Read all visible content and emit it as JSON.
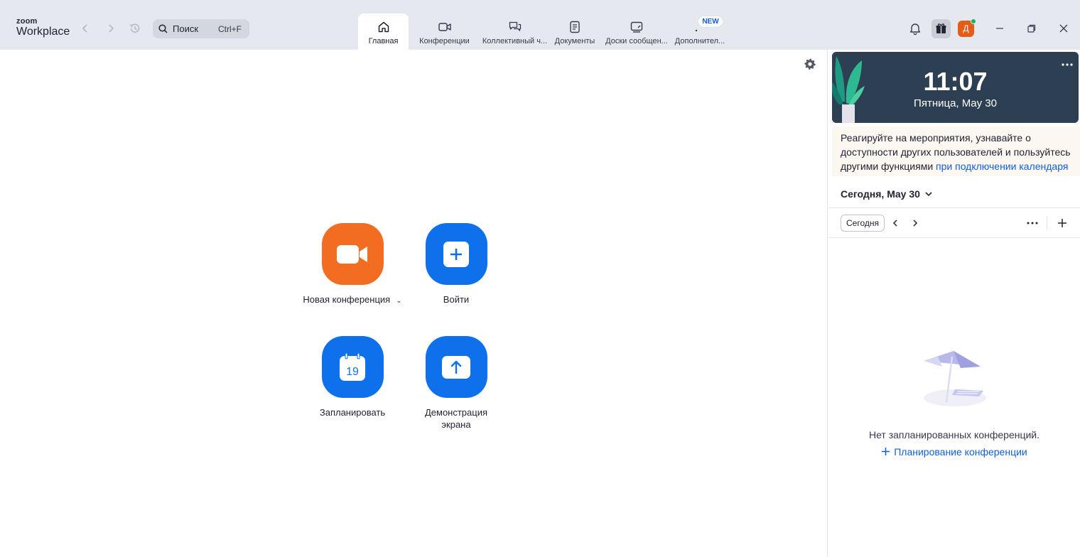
{
  "app": {
    "logo_small": "zoom",
    "logo_big": "Workplace"
  },
  "search": {
    "placeholder": "Поиск",
    "shortcut": "Ctrl+F"
  },
  "tabs": [
    {
      "label": "Главная",
      "icon": "home-icon",
      "active": true
    },
    {
      "label": "Конференции",
      "icon": "video-camera-icon",
      "active": false
    },
    {
      "label": "Коллективный ч...",
      "icon": "chat-icon",
      "active": false
    },
    {
      "label": "Документы",
      "icon": "document-icon",
      "active": false
    },
    {
      "label": "Доски сообщен...",
      "icon": "whiteboard-icon",
      "active": false
    },
    {
      "label": "Дополнител...",
      "icon": "more-dots-icon",
      "active": false,
      "badge": "NEW"
    }
  ],
  "header_right": {
    "avatar_initial": "Д",
    "avatar_color": "#e45d18",
    "presence_color": "#12b76a"
  },
  "actions": [
    {
      "label": "Новая конференция",
      "icon": "video-camera-icon",
      "color": "#f26d21",
      "has_dropdown": true
    },
    {
      "label": "Войти",
      "icon": "plus-icon",
      "color": "#0e71eb"
    },
    {
      "label": "Запланировать",
      "icon": "calendar-icon",
      "calendar_day": "19",
      "color": "#0e71eb"
    },
    {
      "label": "Демонстрация экрана",
      "icon": "share-arrow-up-icon",
      "color": "#0e71eb"
    }
  ],
  "clock": {
    "time": "11:07",
    "date": "Пятница, May 30"
  },
  "notice": {
    "text": "Реагируйте на мероприятия, узнавайте о доступности других пользователей и пользуйтесь другими функциями",
    "link": "при подключении календаря"
  },
  "calendar": {
    "date_selector": "Сегодня, May 30",
    "today_button": "Сегодня",
    "empty_text": "Нет запланированных конференций.",
    "plan_link": "Планирование конференции"
  },
  "colors": {
    "accent": "#0e71eb",
    "link": "#0e5fd8",
    "orange": "#f26d21",
    "topbar_bg": "#e5e8ee",
    "clock_bg": "#2d3f53"
  }
}
